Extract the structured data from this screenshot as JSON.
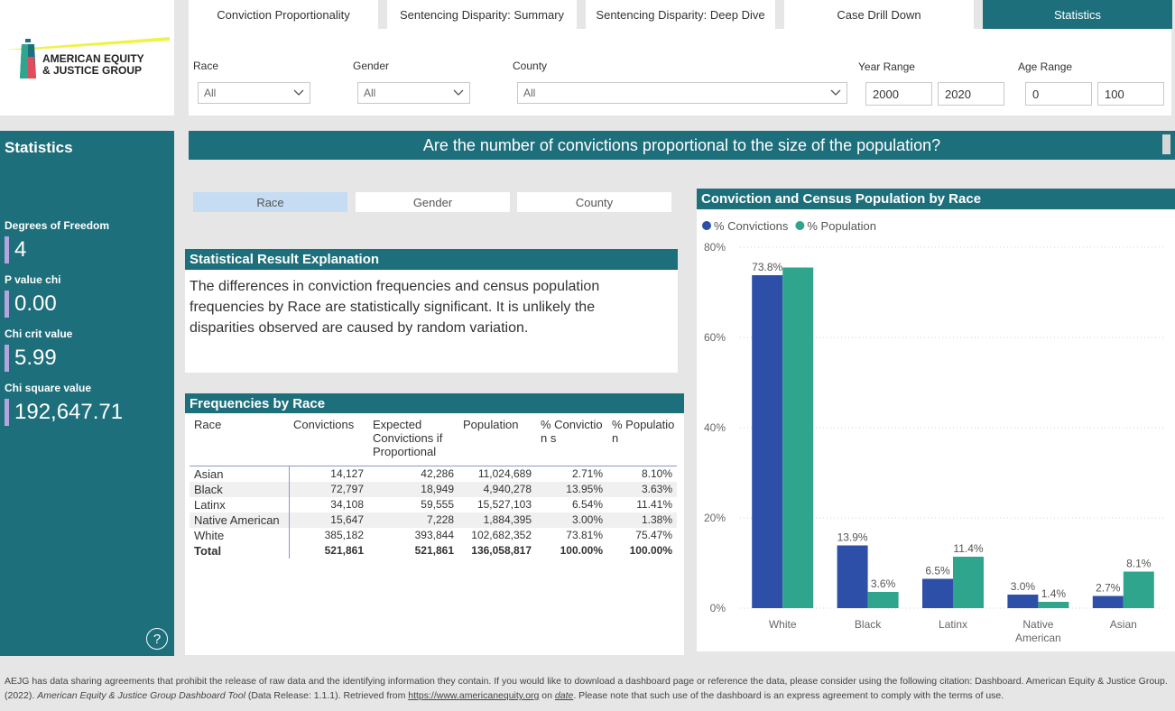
{
  "logo": {
    "line1": "AMERICAN EQUITY",
    "line2": "& JUSTICE GROUP"
  },
  "tabs": [
    {
      "label": "Conviction Proportionality"
    },
    {
      "label": "Sentencing Disparity: Summary"
    },
    {
      "label": "Sentencing Disparity: Deep Dive"
    },
    {
      "label": "Case Drill Down"
    },
    {
      "label": "Statistics",
      "active": true
    }
  ],
  "filters": {
    "race": {
      "label": "Race",
      "value": "All"
    },
    "gender": {
      "label": "Gender",
      "value": "All"
    },
    "county": {
      "label": "County",
      "value": "All"
    },
    "year_range": {
      "label": "Year Range",
      "from": "2000",
      "to": "2020"
    },
    "age_range": {
      "label": "Age Range",
      "from": "0",
      "to": "100"
    }
  },
  "stats_panel": {
    "title": "Statistics",
    "items": [
      {
        "label": "Degrees of Freedom",
        "value": "4"
      },
      {
        "label": "P value chi",
        "value": "0.00"
      },
      {
        "label": "Chi crit value",
        "value": "5.99"
      },
      {
        "label": "Chi square value",
        "value": "192,647.71"
      }
    ],
    "help": "?"
  },
  "banner": "Are the number of convictions proportional to the size of the population?",
  "toggles": [
    {
      "label": "Race",
      "selected": true
    },
    {
      "label": "Gender"
    },
    {
      "label": "County"
    }
  ],
  "explanation": {
    "title": "Statistical Result Explanation",
    "text": "The differences in conviction frequencies and census population frequencies by Race are statistically significant. It is unlikely the disparities observed are caused by random variation."
  },
  "frequency_table": {
    "title": "Frequencies by Race",
    "headers": [
      "Race",
      "Convictions",
      "Expected Convictions if Proportional",
      "Population",
      "% Conviction s",
      "% Populatio n"
    ],
    "rows": [
      [
        "Asian",
        "14,127",
        "42,286",
        "11,024,689",
        "2.71%",
        "8.10%"
      ],
      [
        "Black",
        "72,797",
        "18,949",
        "4,940,278",
        "13.95%",
        "3.63%"
      ],
      [
        "Latinx",
        "34,108",
        "59,555",
        "15,527,103",
        "6.54%",
        "11.41%"
      ],
      [
        "Native American",
        "15,647",
        "7,228",
        "1,884,395",
        "3.00%",
        "1.38%"
      ],
      [
        "White",
        "385,182",
        "393,844",
        "102,682,352",
        "73.81%",
        "75.47%"
      ]
    ],
    "total": [
      "Total",
      "521,861",
      "521,861",
      "136,058,817",
      "100.00%",
      "100.00%"
    ]
  },
  "chart_data": {
    "type": "bar",
    "title": "Conviction and Census Population by Race",
    "categories": [
      "White",
      "Black",
      "Latinx",
      "Native American",
      "Asian"
    ],
    "series": [
      {
        "name": "% Convictions",
        "values": [
          73.8,
          13.9,
          6.5,
          3.0,
          2.7
        ],
        "labels": [
          "73.8%",
          "13.9%",
          "6.5%",
          "3.0%",
          "2.7%"
        ],
        "color": "#2e4fa8"
      },
      {
        "name": "% Population",
        "values": [
          75.5,
          3.6,
          11.4,
          1.4,
          8.1
        ],
        "labels": [
          "",
          "3.6%",
          "11.4%",
          "1.4%",
          "8.1%"
        ],
        "color": "#2fa58e"
      }
    ],
    "ylim": [
      0,
      80
    ],
    "yticks": [
      "0%",
      "20%",
      "40%",
      "60%",
      "80%"
    ],
    "grid": true,
    "legend": "top-left"
  },
  "footer": {
    "text1": "AEJG has data sharing agreements that prohibit the release of raw data and the identifying information they contain. If you would like to download a dashboard page or reference the data, please consider using the following citation: Dashboard. American Equity & Justice Group. (2022). ",
    "tool": "American Equity & Justice Group Dashboard Tool",
    "text2": " (Data Release: 1.1.1). Retrieved from ",
    "link": "https://www.americanequity.org",
    "text3": " on ",
    "date": "date",
    "text4": ". Please note that such use of the dashboard is an express agreement to comply with the terms of use."
  },
  "colors": {
    "teal": "#1e6f7c",
    "conv": "#2e4fa8",
    "pop": "#2fa58e",
    "accent": "#b3a6e0"
  }
}
